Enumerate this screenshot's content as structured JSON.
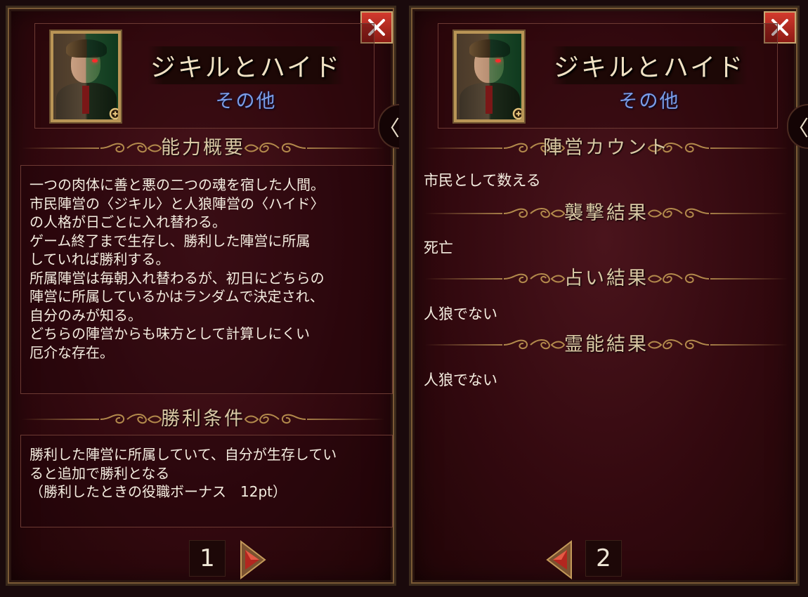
{
  "left_panel": {
    "title": "ジキルとハイド",
    "category": "その他",
    "sections": [
      {
        "heading": "能力概要",
        "lines": [
          "一つの肉体に善と悪の二つの魂を宿した人間。",
          "市民陣営の〈ジキル〉と人狼陣営の〈ハイド〉",
          "の人格が日ごとに入れ替わる。",
          "ゲーム終了まで生存し、勝利した陣営に所属",
          "していれば勝利する。",
          "所属陣営は毎朝入れ替わるが、初日にどちらの",
          "陣営に所属しているかはランダムで決定され、",
          "自分のみが知る。",
          "どちらの陣営からも味方として計算しにくい",
          "厄介な存在。"
        ]
      },
      {
        "heading": "勝利条件",
        "lines": [
          "勝利した陣営に所属していて、自分が生存してい",
          "ると追加で勝利となる",
          "（勝利したときの役職ボーナス　12pt）"
        ]
      }
    ],
    "page_number": "1"
  },
  "right_panel": {
    "title": "ジキルとハイド",
    "category": "その他",
    "sections": [
      {
        "heading": "陣営カウント",
        "value": "市民として数える"
      },
      {
        "heading": "襲撃結果",
        "value": "死亡"
      },
      {
        "heading": "占い結果",
        "value": "人狼でない"
      },
      {
        "heading": "霊能結果",
        "value": "人狼でない"
      }
    ],
    "page_number": "2"
  },
  "side_tab_glyph": "〈",
  "icons": {
    "close": "close-icon",
    "zoom": "magnifier-plus-icon",
    "next": "arrow-right-icon",
    "prev": "arrow-left-icon"
  },
  "colors": {
    "title": "#f1e2c4",
    "category": "#7b9ee8",
    "heading": "#d9c8a4",
    "close_button": "#c42a22",
    "panel_bg": "#3b0c12"
  }
}
